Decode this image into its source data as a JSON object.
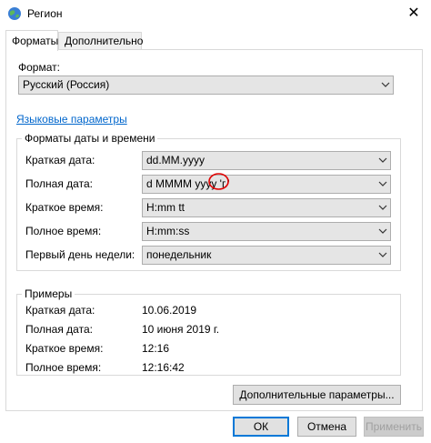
{
  "window": {
    "title": "Регион",
    "icon": "globe-icon",
    "close": "✕"
  },
  "tabs": [
    {
      "label": "Форматы",
      "active": true
    },
    {
      "label": "Дополнительно",
      "active": false
    }
  ],
  "format": {
    "label": "Формат:",
    "value": "Русский (Россия)"
  },
  "language_link": "Языковые параметры",
  "date_time": {
    "title": "Форматы даты и времени",
    "rows": [
      {
        "label": "Краткая дата:",
        "value": "dd.MM.yyyy"
      },
      {
        "label": "Полная дата:",
        "value": "d MMMM yyyy 'г.'"
      },
      {
        "label": "Краткое время:",
        "value": "H:mm tt"
      },
      {
        "label": "Полное время:",
        "value": "H:mm:ss"
      },
      {
        "label": "Первый день недели:",
        "value": "понедельник"
      }
    ]
  },
  "examples": {
    "title": "Примеры",
    "rows": [
      {
        "label": "Краткая дата:",
        "value": "10.06.2019"
      },
      {
        "label": "Полная дата:",
        "value": "10 июня 2019 г."
      },
      {
        "label": "Краткое время:",
        "value": "12:16"
      },
      {
        "label": "Полное время:",
        "value": "12:16:42"
      }
    ]
  },
  "buttons": {
    "advanced": "Дополнительные параметры...",
    "ok": "ОК",
    "cancel": "Отмена",
    "apply": "Применить"
  },
  "colors": {
    "link": "#0066cc",
    "annotation": "#e00000",
    "focus": "#0078d7"
  }
}
